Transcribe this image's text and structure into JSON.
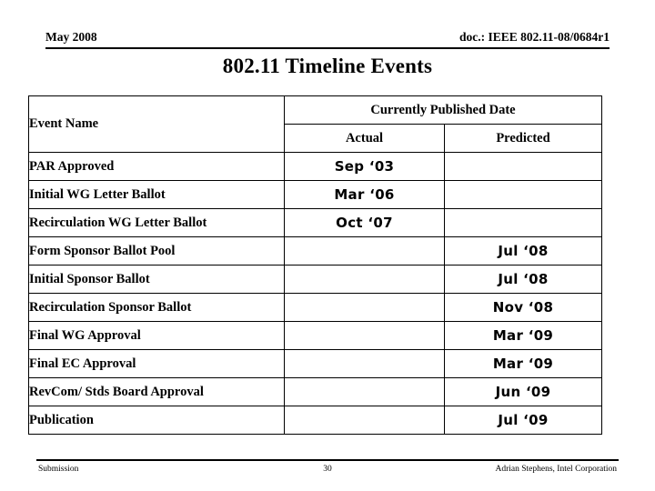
{
  "header": {
    "left": "May 2008",
    "right": "doc.: IEEE 802.11-08/0684r1"
  },
  "title": "802.11 Timeline Events",
  "table": {
    "columns": {
      "event_name": "Event Name",
      "published_date": "Currently Published Date",
      "actual": "Actual",
      "predicted": "Predicted"
    },
    "rows": [
      {
        "event": "PAR Approved",
        "actual": "Sep ‘03",
        "predicted": ""
      },
      {
        "event": "Initial WG Letter Ballot",
        "actual": "Mar ‘06",
        "predicted": ""
      },
      {
        "event": "Recirculation WG Letter Ballot",
        "actual": "Oct ‘07",
        "predicted": ""
      },
      {
        "event": "Form Sponsor Ballot Pool",
        "actual": "",
        "predicted": "Jul ‘08"
      },
      {
        "event": "Initial Sponsor Ballot",
        "actual": "",
        "predicted": "Jul ‘08"
      },
      {
        "event": "Recirculation Sponsor Ballot",
        "actual": "",
        "predicted": "Nov ‘08"
      },
      {
        "event": "Final WG Approval",
        "actual": "",
        "predicted": "Mar ‘09"
      },
      {
        "event": "Final EC Approval",
        "actual": "",
        "predicted": "Mar ‘09"
      },
      {
        "event": "RevCom/ Stds Board Approval",
        "actual": "",
        "predicted": "Jun ‘09"
      },
      {
        "event": "Publication",
        "actual": "",
        "predicted": "Jul ‘09"
      }
    ]
  },
  "footer": {
    "left": "Submission",
    "page": "30",
    "right": "Adrian Stephens, Intel Corporation"
  }
}
